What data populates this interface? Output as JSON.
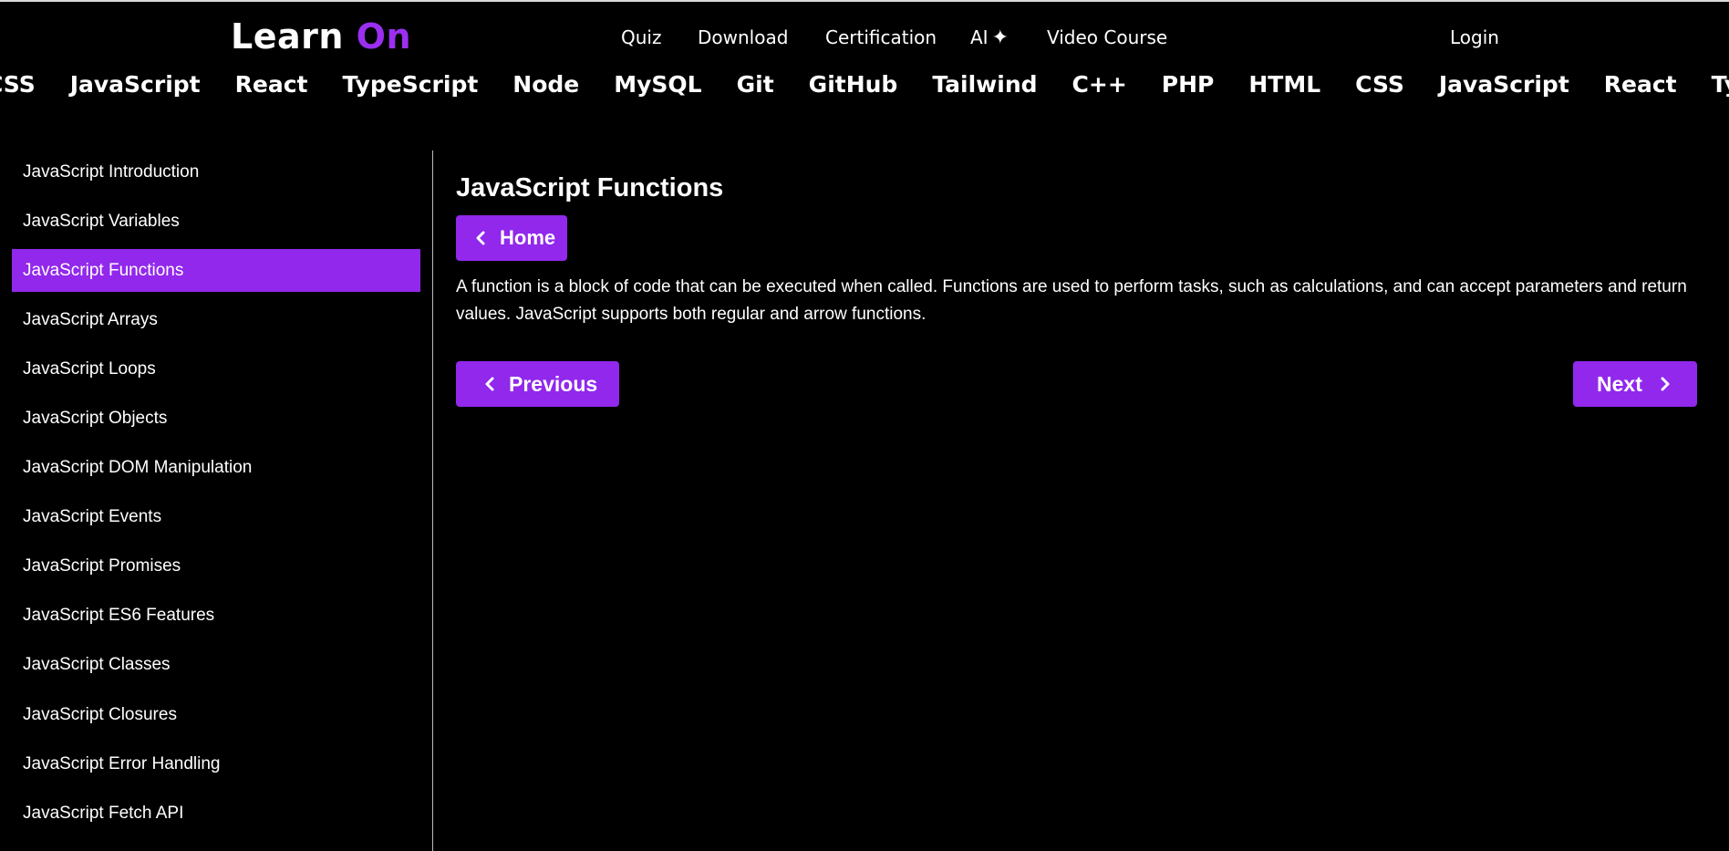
{
  "header": {
    "logo_main": "Learn",
    "logo_accent": "On",
    "nav": {
      "quiz": "Quiz",
      "download": "Download",
      "certification": "Certification",
      "ai": "AI",
      "ai_symbol": "✦",
      "video_course": "Video Course",
      "login": "Login"
    }
  },
  "topics": [
    "CSS",
    "JavaScript",
    "React",
    "TypeScript",
    "Node",
    "MySQL",
    "Git",
    "GitHub",
    "Tailwind",
    "C++",
    "PHP",
    "HTML",
    "CSS",
    "JavaScript",
    "React",
    "TypeScript"
  ],
  "sidebar": {
    "items": [
      {
        "label": "JavaScript Introduction"
      },
      {
        "label": "JavaScript Variables"
      },
      {
        "label": "JavaScript Functions",
        "active": true
      },
      {
        "label": "JavaScript Arrays"
      },
      {
        "label": "JavaScript Loops"
      },
      {
        "label": "JavaScript Objects"
      },
      {
        "label": "JavaScript DOM Manipulation"
      },
      {
        "label": "JavaScript Events"
      },
      {
        "label": "JavaScript Promises"
      },
      {
        "label": "JavaScript ES6 Features"
      },
      {
        "label": "JavaScript Classes"
      },
      {
        "label": "JavaScript Closures"
      },
      {
        "label": "JavaScript Error Handling"
      },
      {
        "label": "JavaScript Fetch API"
      }
    ]
  },
  "main": {
    "title": "JavaScript Functions",
    "home_label": "Home",
    "description": "A function is a block of code that can be executed when called. Functions are used to perform tasks, such as calculations, and can accept parameters and return values. JavaScript supports both regular and arrow functions.",
    "previous_label": "Previous",
    "next_label": "Next"
  },
  "colors": {
    "accent": "#9128ec",
    "logo_accent": "#9a2ff0",
    "background": "#000000",
    "text": "#ffffff"
  },
  "icons": {
    "home": "chevron-left-icon",
    "previous": "chevron-left-icon",
    "next": "chevron-right-icon"
  }
}
